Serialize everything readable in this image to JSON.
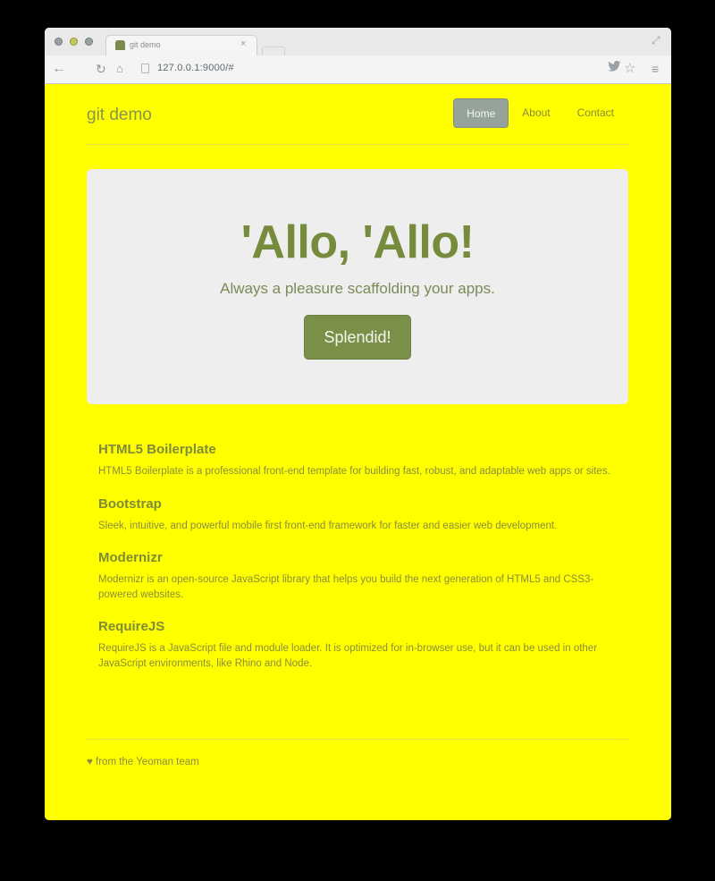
{
  "browser": {
    "tab_title": "git demo",
    "tab_close": "×",
    "url": "127.0.0.1:9000/#",
    "icons": {
      "back": "←",
      "reload": "↻",
      "home": "⌂",
      "twitter": "✉",
      "star": "☆",
      "menu": "≡",
      "fullscreen": "⤢"
    }
  },
  "navbar": {
    "brand": "git demo",
    "items": [
      {
        "label": "Home",
        "active": true
      },
      {
        "label": "About",
        "active": false
      },
      {
        "label": "Contact",
        "active": false
      }
    ]
  },
  "jumbotron": {
    "title": "'Allo, 'Allo!",
    "subtitle": "Always a pleasure scaffolding your apps.",
    "button": "Splendid!"
  },
  "features": [
    {
      "title": "HTML5 Boilerplate",
      "text": "HTML5 Boilerplate is a professional front-end template for building fast, robust, and adaptable web apps or sites."
    },
    {
      "title": "Bootstrap",
      "text": "Sleek, intuitive, and powerful mobile first front-end framework for faster and easier web development."
    },
    {
      "title": "Modernizr",
      "text": "Modernizr is an open-source JavaScript library that helps you build the next generation of HTML5 and CSS3-powered websites."
    },
    {
      "title": "RequireJS",
      "text": "RequireJS is a JavaScript file and module loader. It is optimized for in-browser use, but it can be used in other JavaScript environments, like Rhino and Node."
    }
  ],
  "footer": "♥ from the Yeoman team",
  "colors": {
    "page_background": "#ffff00",
    "jumbotron_background": "#eeeeee",
    "accent": "#7a8f48",
    "active_nav": "#95a39b"
  }
}
